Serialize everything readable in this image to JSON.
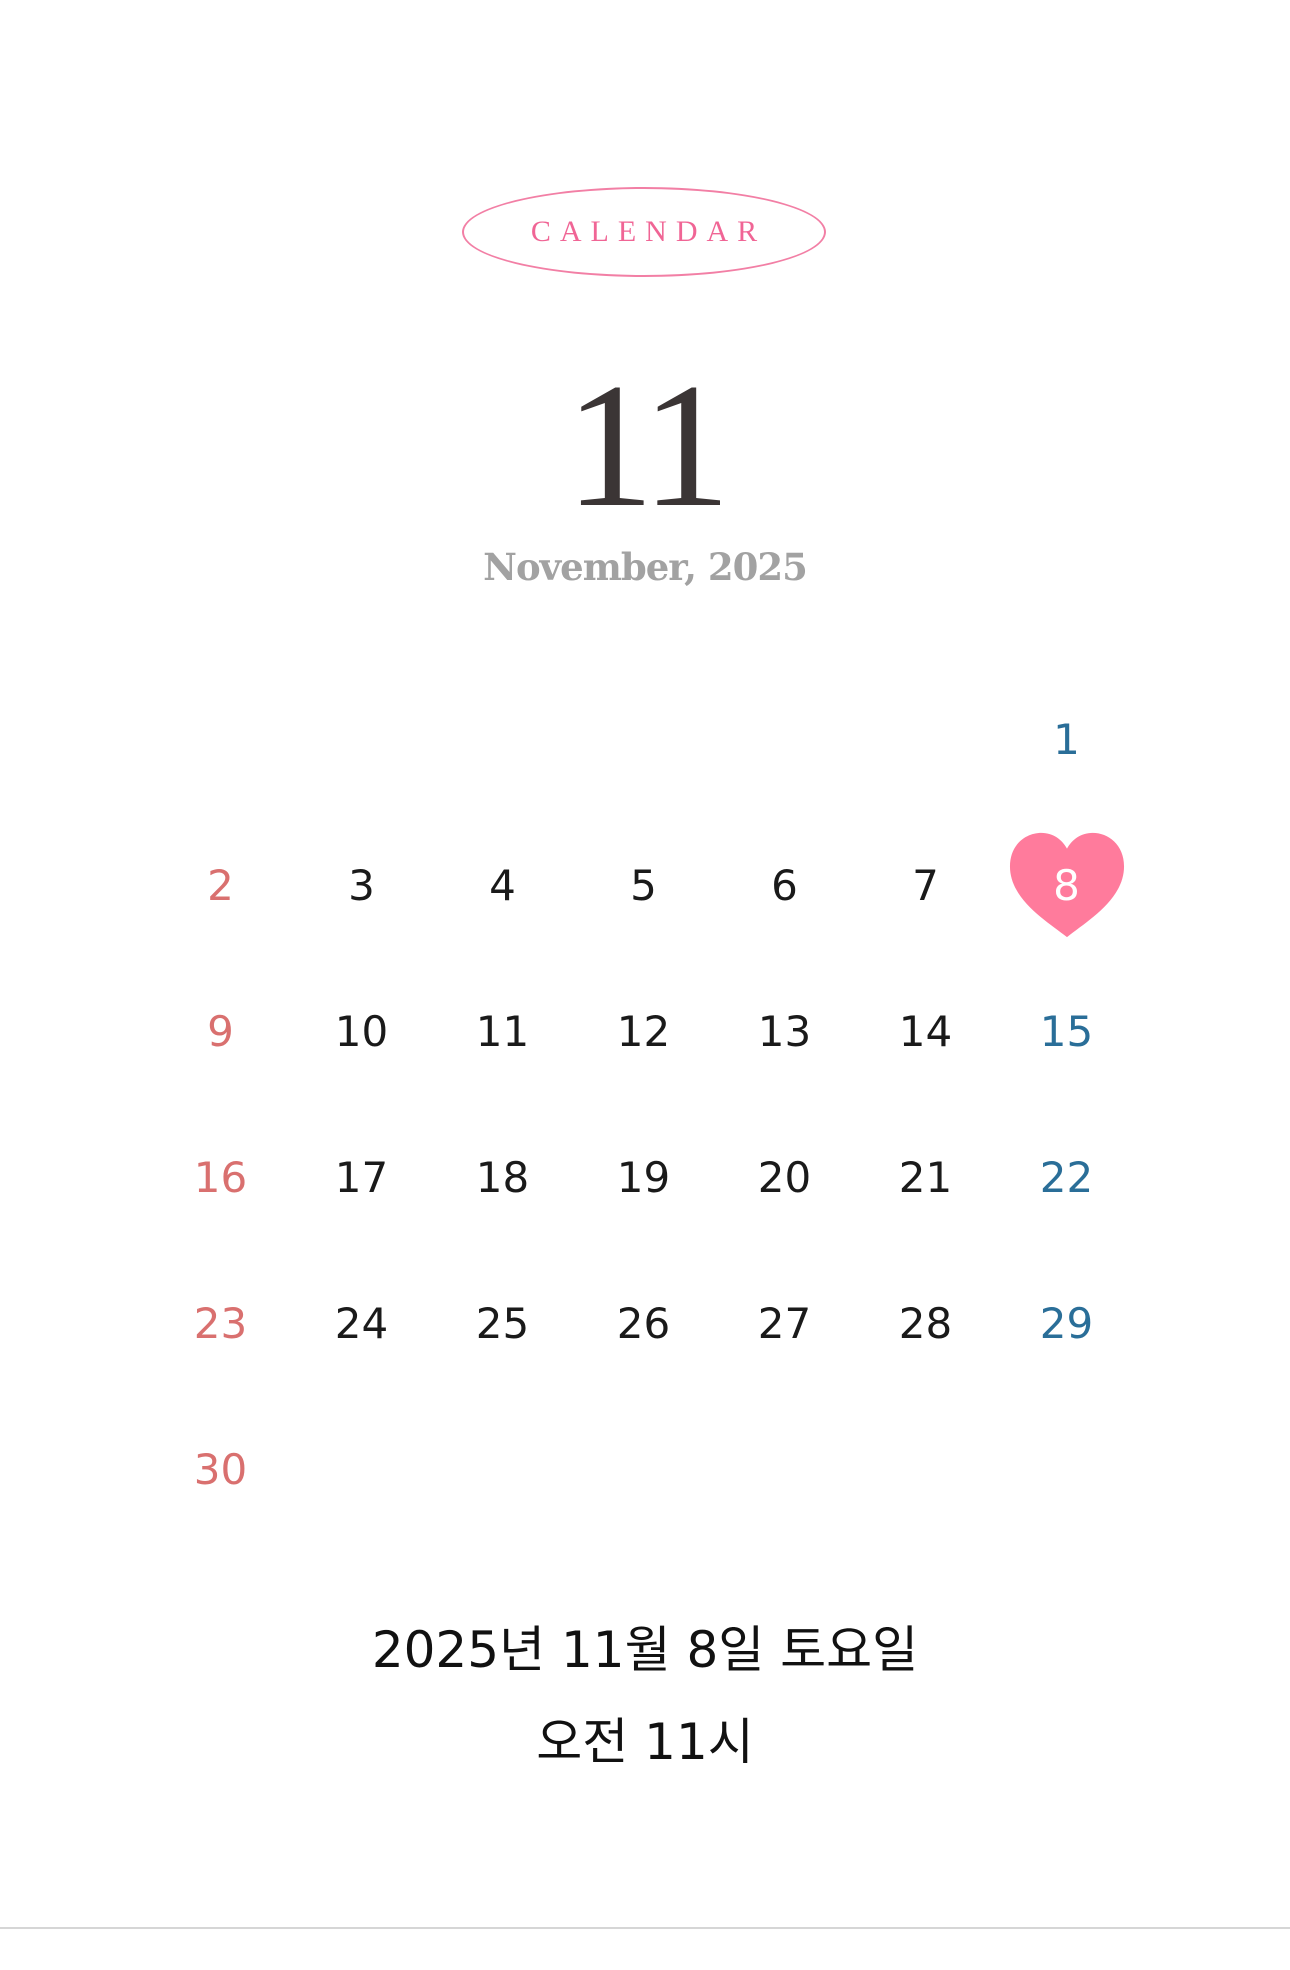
{
  "header": {
    "badge_label": "CALENDAR",
    "month_number": "11",
    "month_subtitle": "November, 2025"
  },
  "calendar": {
    "first_weekday_index": 6,
    "days_in_month": 30,
    "selected_day": 8,
    "days": [
      "1",
      "2",
      "3",
      "4",
      "5",
      "6",
      "7",
      "8",
      "9",
      "10",
      "11",
      "12",
      "13",
      "14",
      "15",
      "16",
      "17",
      "18",
      "19",
      "20",
      "21",
      "22",
      "23",
      "24",
      "25",
      "26",
      "27",
      "28",
      "29",
      "30"
    ]
  },
  "datetime": {
    "line1": "2025년 11월 8일 토요일",
    "line2": "오전 11시"
  },
  "colors": {
    "accent": "#f27fa5",
    "heart": "#ff7b9c",
    "sunday": "#d9706f",
    "saturday": "#2a6e98",
    "weekday": "#1a1a1a",
    "month_number": "#3b3535",
    "month_subtitle": "#a2a2a2"
  }
}
